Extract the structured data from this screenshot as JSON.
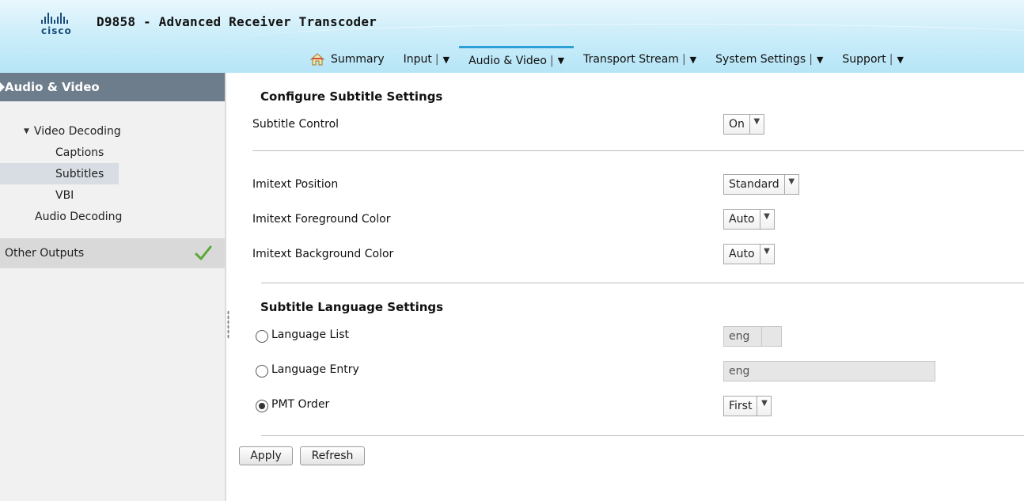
{
  "header": {
    "logo_text": "cisco",
    "title": "D9858 - Advanced Receiver Transcoder"
  },
  "nav": {
    "items": [
      {
        "label": "Summary",
        "icon": "home-icon"
      },
      {
        "label": "Input",
        "sep": "|",
        "caret": "▼"
      },
      {
        "label": "Audio & Video",
        "sep": "|",
        "caret": "▼"
      },
      {
        "label": "Transport Stream",
        "sep": "|",
        "caret": "▼"
      },
      {
        "label": "System Settings",
        "sep": "|",
        "caret": "▼"
      },
      {
        "label": "Support",
        "sep": "|",
        "caret": "▼"
      }
    ],
    "active": "Audio & Video"
  },
  "sidebar": {
    "section_title": "Audio & Video",
    "tree": {
      "video_decoding": "Video Decoding",
      "captions": "Captions",
      "subtitles": "Subtitles",
      "vbi": "VBI",
      "audio_decoding": "Audio Decoding"
    },
    "other_outputs": "Other Outputs"
  },
  "main": {
    "configure_heading": "Configure Subtitle Settings",
    "subtitle_control_label": "Subtitle Control",
    "subtitle_control_value": "On",
    "imitext_position_label": "Imitext Position",
    "imitext_position_value": "Standard",
    "imitext_fg_label": "Imitext Foreground Color",
    "imitext_fg_value": "Auto",
    "imitext_bg_label": "Imitext Background Color",
    "imitext_bg_value": "Auto",
    "language_heading": "Subtitle Language Settings",
    "language_list_label": "Language List",
    "language_list_value": "eng",
    "language_entry_label": "Language Entry",
    "language_entry_value": "eng",
    "pmt_order_label": "PMT Order",
    "pmt_order_value": "First",
    "selected_radio": "PMT Order"
  },
  "buttons": {
    "apply": "Apply",
    "refresh": "Refresh"
  },
  "colors": {
    "header_bg": "#cdeefa",
    "sidebar_section": "#6e7d8c",
    "active_tab": "#2f9fd7",
    "check": "#5aa832"
  }
}
